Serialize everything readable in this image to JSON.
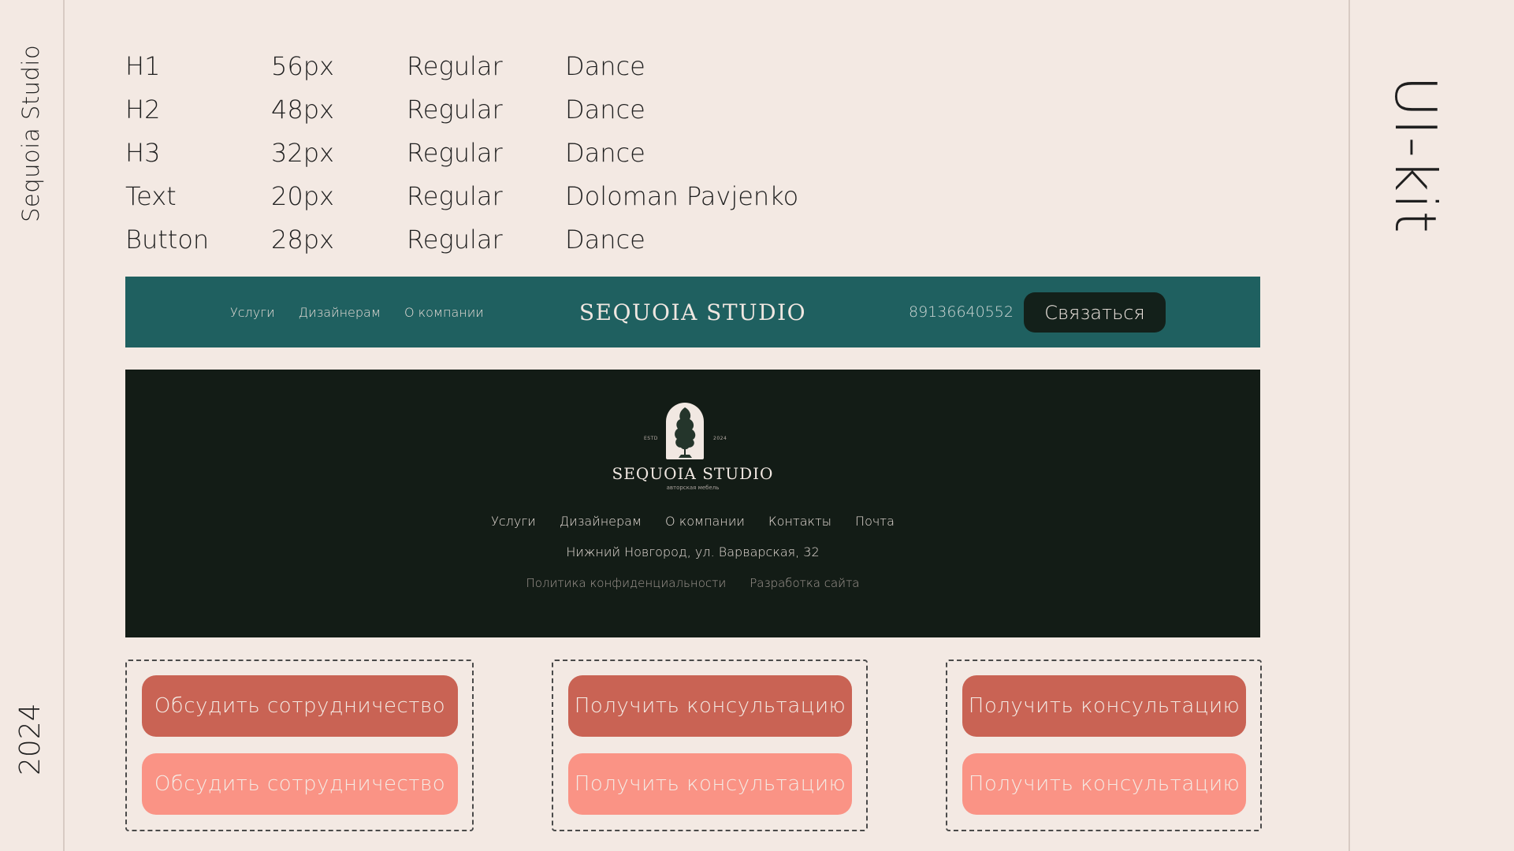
{
  "side": {
    "brand": "Sequoia Studio",
    "year": "2024",
    "kit_title": "UI-kit"
  },
  "typography": [
    {
      "style": "H1",
      "size": "56px",
      "weight": "Regular",
      "font": "Dance"
    },
    {
      "style": "H2",
      "size": "48px",
      "weight": "Regular",
      "font": "Dance"
    },
    {
      "style": "H3",
      "size": "32px",
      "weight": "Regular",
      "font": "Dance"
    },
    {
      "style": "Text",
      "size": "20px",
      "weight": "Regular",
      "font": "Doloman Pavjenko"
    },
    {
      "style": "Button",
      "size": "28px",
      "weight": "Regular",
      "font": "Dance"
    }
  ],
  "header": {
    "nav": [
      "Услуги",
      "Дизайнерам",
      "О компании"
    ],
    "logo": "SEQUOIA STUDIO",
    "phone": "89136640552",
    "cta_label": "Связаться"
  },
  "footer": {
    "estd_left": "ESTD",
    "estd_right": "2024",
    "logo": "SEQUOIA STUDIO",
    "tagline": "авторская мебель",
    "nav": [
      "Услуги",
      "Дизайнерам",
      "О компании",
      "Контакты",
      "Почта"
    ],
    "address": "Нижний Новгород, ул. Варварская, 32",
    "links": [
      "Политика конфиденциальности",
      "Разработка сайта"
    ]
  },
  "buttons": [
    {
      "primary": "Обсудить сотрудничество",
      "secondary": "Обсудить сотрудничество"
    },
    {
      "primary": "Получить консультацию",
      "secondary": "Получить консультацию"
    },
    {
      "primary": "Получить консультацию",
      "secondary": "Получить консультацию"
    }
  ],
  "colors": {
    "background": "#f3e9e3",
    "header_teal": "#1f6060",
    "footer_dark": "#131c16",
    "button_primary": "#c96354",
    "button_secondary": "#fa9385"
  }
}
